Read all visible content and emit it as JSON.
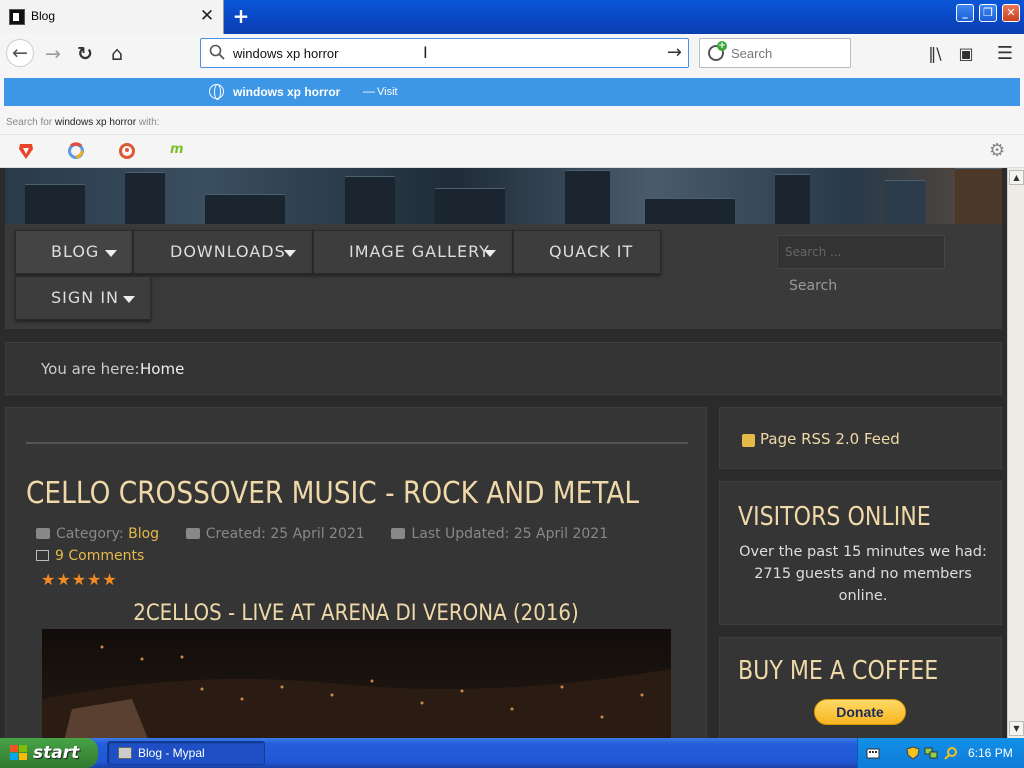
{
  "browser": {
    "tab_title": "Blog",
    "tab_close": "✕",
    "new_tab": "+",
    "url_value": "windows xp horror",
    "search_placeholder": "Search"
  },
  "dropdown": {
    "query": "windows xp horror",
    "separator": "—",
    "visit_label": "Visit",
    "search_for_prefix": "Search for",
    "search_for_query": "windows xp horror",
    "search_for_suffix": "with:"
  },
  "site": {
    "menu": [
      {
        "label": "BLOG"
      },
      {
        "label": "DOWNLOADS"
      },
      {
        "label": "IMAGE GALLERY"
      },
      {
        "label": "QUACK IT"
      },
      {
        "label": "SIGN IN"
      }
    ],
    "search_placeholder": "Search ...",
    "search_button": "Search",
    "breadcrumb_prefix": "You are here:",
    "breadcrumb_home": "Home"
  },
  "article": {
    "title": "CELLO CROSSOVER MUSIC - ROCK AND METAL",
    "category_label": "Category:",
    "category_value": "Blog",
    "created": "Created: 25 April 2021",
    "updated": "Last Updated: 25 April 2021",
    "comments": "9 Comments",
    "stars": "★★★★★",
    "video_title": "2CELLOS - LIVE AT ARENA DI VERONA (2016)"
  },
  "sidebar": {
    "rss": "Page RSS 2.0 Feed",
    "visitors_title": "VISITORS ONLINE",
    "visitors_text": "Over the past 15 minutes we had: 2715 guests and no members online.",
    "coffee_title": "BUY ME A COFFEE",
    "donate": "Donate"
  },
  "taskbar": {
    "start": "start",
    "task": "Blog - Mypal",
    "clock": "6:16 PM"
  },
  "colors": {
    "accent_gold": "#f0d9a8",
    "link_gold": "#e6b94a",
    "star_orange": "#f08a25",
    "dropdown_blue": "#3d96e6"
  }
}
